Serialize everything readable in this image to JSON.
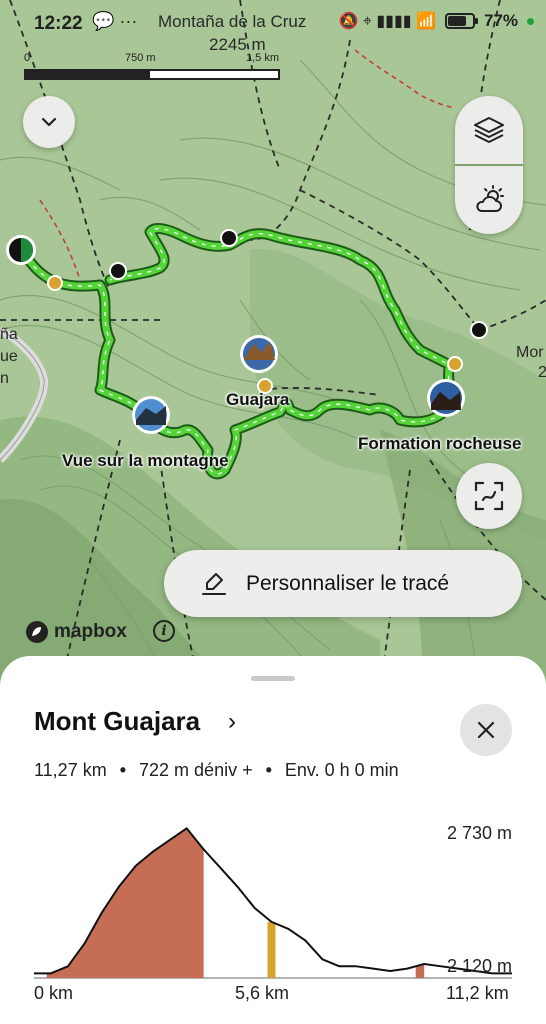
{
  "status_bar": {
    "time": "12:22",
    "left_icons": "💬 ···",
    "signal_icons": "🔕 ⌖ ▮▮▮▮ 📶",
    "battery_percent": 77,
    "battery_text": "77%"
  },
  "map": {
    "peak": {
      "name": "Montaña de la Cruz",
      "elevation": "2245 m"
    },
    "scale": {
      "label_0": "0",
      "label_mid": "750 m",
      "label_max": "1,5 km"
    },
    "labels": {
      "guajara": "Guajara",
      "vue": "Vue sur la montagne",
      "formation": "Formation rocheuse",
      "edge_left_1": "ña",
      "edge_left_2": "ue",
      "edge_left_3": "n",
      "edge_right_1": "Mor",
      "edge_right_2": "2"
    },
    "mapbox_text": "mapbox",
    "info_glyph": "i"
  },
  "buttons": {
    "collapse_icon": "chevron-down-icon",
    "layers_icon": "layers-icon",
    "weather_icon": "weather-icon",
    "recenter_icon": "recenter-icon",
    "customize_label": "Personnaliser le tracé"
  },
  "sheet": {
    "title": "Mont Guajara",
    "chevron": "›",
    "stats": {
      "distance": "11,27 km",
      "elevation_gain": "722 m déniv +",
      "duration": "Env. 0 h 0 min",
      "separator": "•"
    }
  },
  "colors": {
    "route": "#3fbe2b",
    "climb": "#c56e55",
    "poi": "#d9a22e",
    "map_bg": "#a9c796"
  },
  "chart_data": {
    "type": "area",
    "ylabel_max": "2 730 m",
    "ylabel_min": "2 120 m",
    "xlabels": [
      "0 km",
      "5,6 km",
      "11,2 km"
    ],
    "x_km": [
      0,
      0.4,
      0.8,
      1.2,
      1.6,
      2.0,
      2.4,
      2.8,
      3.2,
      3.6,
      4.0,
      4.4,
      4.8,
      5.2,
      5.6,
      6.0,
      6.4,
      6.8,
      7.2,
      7.6,
      8.0,
      8.4,
      8.8,
      9.2,
      9.6,
      10.0,
      10.4,
      10.8,
      11.27
    ],
    "elevation_m": [
      2120,
      2120,
      2150,
      2250,
      2380,
      2490,
      2580,
      2640,
      2690,
      2740,
      2650,
      2570,
      2490,
      2400,
      2340,
      2310,
      2260,
      2180,
      2150,
      2150,
      2140,
      2130,
      2140,
      2160,
      2150,
      2140,
      2130,
      2120,
      2120
    ],
    "highlight_ranges_km": [
      [
        0.3,
        4.0
      ],
      [
        9.0,
        9.2
      ]
    ],
    "poi_marker_km": [
      5.6
    ],
    "ylim": [
      2100,
      2750
    ]
  }
}
